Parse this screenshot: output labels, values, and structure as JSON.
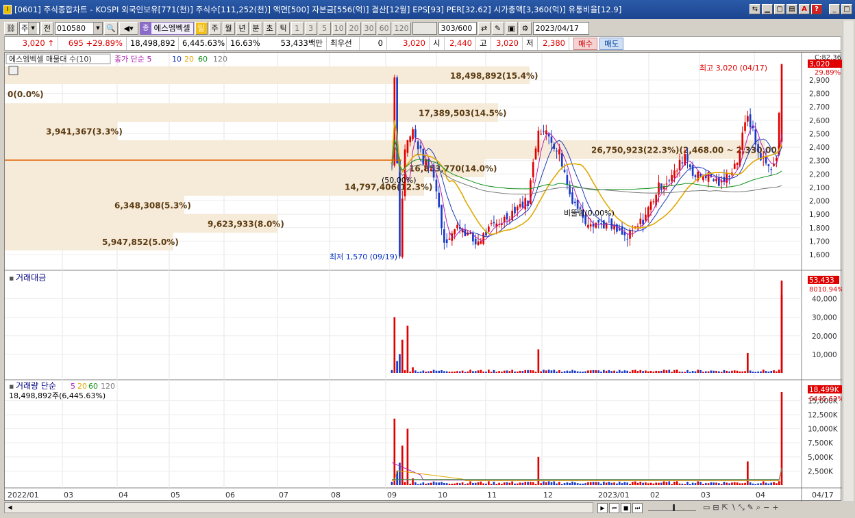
{
  "window": {
    "title": "[0601] 주식종합차트 - KOSPI 외국인보유[771(천)] 주식수[111,252(천)] 액면[500] 자본금[556(억)] 결산[12월] EPS[93] PER[32.62] 시가총액[3,360(억)] 유통비율[12.9]",
    "app_icon": "I"
  },
  "toolbar": {
    "mode_combo": "주",
    "prev_label": "전",
    "code": "010580",
    "stock_name": "에스엠벡셀",
    "name_tag": "종",
    "periods": [
      "일",
      "주",
      "월",
      "년",
      "분",
      "초",
      "틱"
    ],
    "selected_period": "일",
    "intervals": [
      "1",
      "3",
      "5",
      "10",
      "20",
      "30",
      "60",
      "120"
    ],
    "count_value": "303",
    "count_max": "/600",
    "date_value": "2023/04/17"
  },
  "quote": {
    "price": "3,020",
    "arrow": "↑",
    "change": "695",
    "rate": "+29.89%",
    "volume": "18,498,892",
    "vol_ratio": "6,445.63%",
    "turnover": "16.63%",
    "amount": "53,433백만",
    "pref_label": "최우선",
    "pref_value": "0",
    "ask": "3,020",
    "open_label": "시",
    "open": "2,440",
    "high_label": "고",
    "high": "3,020",
    "low_label": "저",
    "low": "2,380",
    "buy_label": "매수",
    "sell_label": "매도"
  },
  "price_panel": {
    "header_name": "에스엠벡셀 매물대 수(10)",
    "ma_title": "종가 단순 5",
    "ma_periods": [
      "10",
      "20",
      "60",
      "120"
    ],
    "ma_colors": [
      "#b020b0",
      "#1a3ab8",
      "#e0a800",
      "#10901c",
      "#7a7a7a"
    ],
    "y_ticks": [
      "2,900",
      "2,800",
      "2,700",
      "2,600",
      "2,500",
      "2,400",
      "2,300",
      "2,200",
      "2,100",
      "2,000",
      "1,900",
      "1,800",
      "1,700",
      "1,600"
    ],
    "top_tick": "C:82.36",
    "last_price_box": "3,020",
    "last_rate_box": "29.89%",
    "high_label": "최고 3,020 (04/17)",
    "low_label": "최저 1,570 (09/19)",
    "pct_marker": "(50.00%)",
    "bep_marker": "비뚤림(0.00%)",
    "volume_profile": [
      {
        "label": "18,498,892(15.4%)",
        "share": 15.4
      },
      {
        "label": "0(0.0%)",
        "share": 0
      },
      {
        "label": "17,389,503(14.5%)",
        "share": 14.5
      },
      {
        "label": "3,941,367(3.3%)",
        "share": 3.3
      },
      {
        "label": "26,750,923(22.3%)(2,468.00 ~ 2,330.00)",
        "share": 22.3
      },
      {
        "label": "16,853,770(14.0%)",
        "share": 14.0
      },
      {
        "label": "14,797,406(12.3%)",
        "share": 12.3
      },
      {
        "label": "6,348,308(5.3%)",
        "share": 5.3
      },
      {
        "label": "9,623,933(8.0%)",
        "share": 8.0
      },
      {
        "label": "5,947,852(5.0%)",
        "share": 5.0
      }
    ]
  },
  "amount_panel": {
    "title": "거래대금",
    "y_ticks": [
      "40,000",
      "30,000",
      "20,000",
      "10,000"
    ],
    "last_box": "53,433",
    "last_ratio": "8010.94%"
  },
  "volume_panel": {
    "title": "거래량 단순",
    "ma_periods": [
      "5",
      "20",
      "60",
      "120"
    ],
    "sub_label": "18,498,892주(6,445.63%)",
    "y_ticks": [
      "15,000K",
      "12,500K",
      "10,000K",
      "7,500K",
      "5,000K",
      "2,500K"
    ],
    "last_box": "18,499K",
    "last_ratio": "6445.63%"
  },
  "x_axis": {
    "labels": [
      "2022/01",
      "03",
      "04",
      "05",
      "06",
      "07",
      "08",
      "09",
      "10",
      "11",
      "12",
      "2023/01",
      "02",
      "03",
      "04"
    ],
    "last_date": "04/17"
  },
  "colors": {
    "up": "#e00000",
    "down": "#1a3ac8",
    "profile": "#f6ead8",
    "profile_text": "#5a3a10",
    "price_line": "#e06000"
  }
}
